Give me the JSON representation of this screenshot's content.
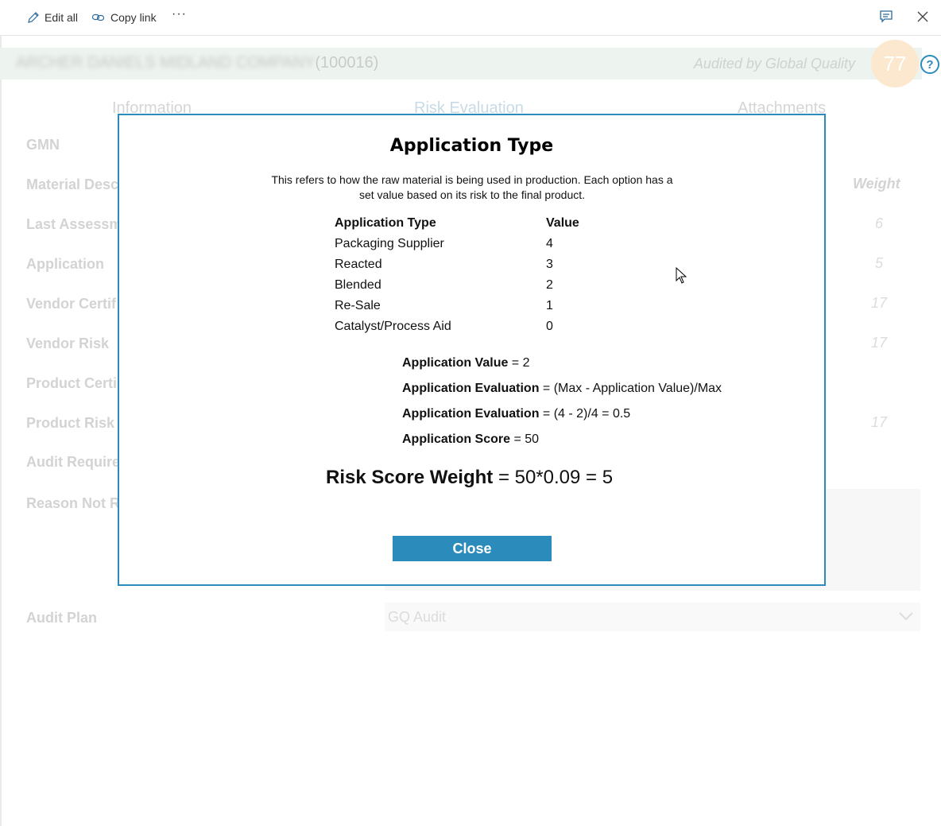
{
  "toolbar": {
    "edit_all": "Edit all",
    "copy_link": "Copy link",
    "more": "···"
  },
  "header": {
    "company_blurred": "ARCHER DANIELS MIDLAND COMPANY",
    "company_id": "(100016)",
    "audited_by": "Audited by Global Quality",
    "score": "77",
    "help": "?"
  },
  "tabs": [
    "Information",
    "Risk Evaluation",
    "Attachments"
  ],
  "form": {
    "labels": [
      "GMN",
      "Material Desc",
      "Last Assessme",
      "Application",
      "Vendor Certif",
      "Vendor Risk",
      "Product Certi",
      "Product Risk",
      "Audit Require",
      "Reason Not R",
      "Audit Plan"
    ],
    "weight_header": "Weight",
    "weights": [
      "6",
      "5",
      "17",
      "17",
      "17"
    ],
    "audit_plan_value": "GQ Audit"
  },
  "modal": {
    "title": "Application Type",
    "description": "This refers to how the raw material is being used in production. Each option has a set value based on its risk to the final product.",
    "table_headers": [
      "Application Type",
      "Value"
    ],
    "table_rows": [
      [
        "Packaging Supplier",
        "4"
      ],
      [
        "Reacted",
        "3"
      ],
      [
        "Blended",
        "2"
      ],
      [
        "Re-Sale",
        "1"
      ],
      [
        "Catalyst/Process Aid",
        "0"
      ]
    ],
    "formulas": [
      {
        "label": "Application Value",
        "expr": " = 2"
      },
      {
        "label": "Application Evaluation",
        "expr": " = (Max - Application Value)/Max"
      },
      {
        "label": "Application Evaluation",
        "expr": " = (4 - 2)/4 = 0.5"
      },
      {
        "label": "Application Score",
        "expr": " = 50"
      }
    ],
    "risk_label": "Risk Score Weight",
    "risk_expr": " = 50*0.09 = 5",
    "close_label": "Close"
  },
  "colors": {
    "accent": "#2b8cbb",
    "banner": "#edf3ee",
    "score_circle": "#fbe8cf"
  }
}
